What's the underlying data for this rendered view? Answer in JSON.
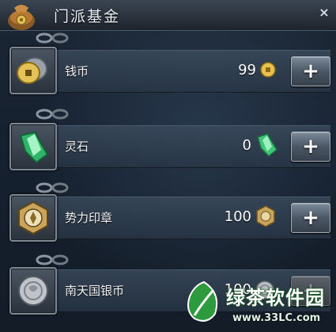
{
  "window": {
    "title": "门派基金",
    "close_label": "×"
  },
  "currencies": [
    {
      "name": "钱币",
      "amount": "99",
      "icon": "coin-stack-icon",
      "amount_icon": "gold-coin-icon",
      "add_label": "+"
    },
    {
      "name": "灵石",
      "amount": "0",
      "icon": "spirit-stone-icon",
      "amount_icon": "spirit-stone-icon",
      "add_label": "+"
    },
    {
      "name": "势力印章",
      "amount": "100",
      "icon": "faction-seal-icon",
      "amount_icon": "faction-seal-icon",
      "add_label": "+"
    },
    {
      "name": "南天国银币",
      "amount": "100",
      "icon": "silver-coin-icon",
      "amount_icon": "silver-coin-icon",
      "add_label": "+"
    }
  ],
  "watermark": {
    "site_name": "绿茶软件园",
    "url": "www.33LC.com"
  },
  "colors": {
    "panel_bg": "#162130",
    "row_bg": "#3e4e60",
    "text": "#f2f4f6",
    "watermark_green": "#1c7a2b"
  }
}
